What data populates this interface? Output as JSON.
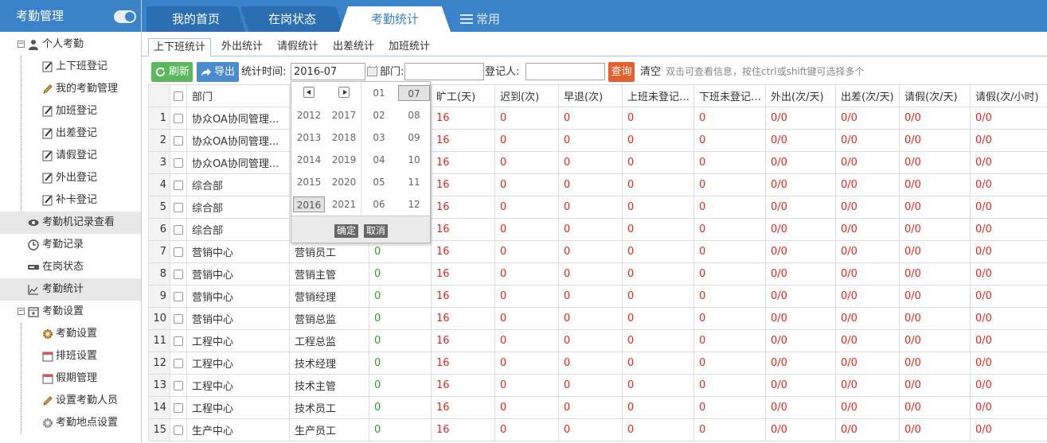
{
  "sidebar": {
    "title": "考勤管理",
    "groups": [
      {
        "label": "个人考勤",
        "icon": "user-icon",
        "items": [
          {
            "label": "上下班登记",
            "icon": "edit-icon"
          },
          {
            "label": "我的考勤管理",
            "icon": "pencil-icon"
          },
          {
            "label": "加班登记",
            "icon": "edit-icon"
          },
          {
            "label": "出差登记",
            "icon": "edit-icon"
          },
          {
            "label": "请假登记",
            "icon": "edit-icon"
          },
          {
            "label": "外出登记",
            "icon": "edit-icon"
          },
          {
            "label": "补卡登记",
            "icon": "edit-icon"
          }
        ]
      },
      {
        "label": "考勤机记录查看",
        "icon": "eye-icon"
      },
      {
        "label": "考勤记录",
        "icon": "clock-icon"
      },
      {
        "label": "在岗状态",
        "icon": "card-icon"
      },
      {
        "label": "考勤统计",
        "icon": "chart-icon"
      },
      {
        "label": "考勤设置",
        "icon": "calendar-plus-icon",
        "items": [
          {
            "label": "考勤设置",
            "icon": "gear-icon"
          },
          {
            "label": "排班设置",
            "icon": "calendar-icon"
          },
          {
            "label": "假期管理",
            "icon": "calendar-icon"
          },
          {
            "label": "设置考勤人员",
            "icon": "pencil-icon"
          },
          {
            "label": "考勤地点设置",
            "icon": "gear-icon"
          }
        ]
      }
    ]
  },
  "top_tabs": [
    "我的首页",
    "在岗状态",
    "考勤统计",
    "常用"
  ],
  "sub_tabs": [
    "上下班统计",
    "外出统计",
    "请假统计",
    "出差统计",
    "加班统计"
  ],
  "toolbar": {
    "refresh": "刷新",
    "export": "导出",
    "period_label": "统计时间:",
    "period_value": "2016-07",
    "dept_label": "部门:",
    "registrant_label": "登记人:",
    "query": "查询",
    "clear": "清空",
    "hint": "双击可查看信息，按住ctrl或shift键可选择多个"
  },
  "picker": {
    "years_left": [
      "2012",
      "2013",
      "2014",
      "2015",
      "2016"
    ],
    "years_right": [
      "2017",
      "2018",
      "2019",
      "2020",
      "2021"
    ],
    "months_left": [
      "01",
      "02",
      "03",
      "04",
      "05",
      "06"
    ],
    "months_right": [
      "07",
      "08",
      "09",
      "10",
      "11",
      "12"
    ],
    "selected_year": "2016",
    "selected_month": "07",
    "ok": "确定",
    "cancel": "取消"
  },
  "table": {
    "headers": [
      "部门",
      "",
      "",
      "旷工(天)",
      "迟到(次)",
      "早退(次)",
      "上班未登记(次)",
      "下班未登记(次)",
      "外出(次/天)",
      "出差(次/天)",
      "请假(次/天)",
      "请假(次/小时)"
    ],
    "rows": [
      {
        "no": "1",
        "dept": "协众OA协同管理...",
        "pos": "",
        "c1": "",
        "absent": "16",
        "late": "0",
        "early": "0",
        "nocheckin": "0",
        "nocheckout": "0",
        "out": "0/0",
        "trip": "0/0",
        "leave": "0/0",
        "leaveh": "0/0"
      },
      {
        "no": "2",
        "dept": "协众OA协同管理...",
        "pos": "",
        "c1": "",
        "absent": "16",
        "late": "0",
        "early": "0",
        "nocheckin": "0",
        "nocheckout": "0",
        "out": "0/0",
        "trip": "0/0",
        "leave": "0/0",
        "leaveh": "0/0"
      },
      {
        "no": "3",
        "dept": "协众OA协同管理...",
        "pos": "",
        "c1": "",
        "absent": "16",
        "late": "0",
        "early": "0",
        "nocheckin": "0",
        "nocheckout": "0",
        "out": "0/0",
        "trip": "0/0",
        "leave": "0/0",
        "leaveh": "0/0"
      },
      {
        "no": "4",
        "dept": "综合部",
        "pos": "",
        "c1": "",
        "absent": "16",
        "late": "0",
        "early": "0",
        "nocheckin": "0",
        "nocheckout": "0",
        "out": "0/0",
        "trip": "0/0",
        "leave": "0/0",
        "leaveh": "0/0"
      },
      {
        "no": "5",
        "dept": "综合部",
        "pos": "",
        "c1": "",
        "absent": "16",
        "late": "0",
        "early": "0",
        "nocheckin": "0",
        "nocheckout": "0",
        "out": "0/0",
        "trip": "0/0",
        "leave": "0/0",
        "leaveh": "0/0"
      },
      {
        "no": "6",
        "dept": "综合部",
        "pos": "",
        "c1": "",
        "absent": "16",
        "late": "0",
        "early": "0",
        "nocheckin": "0",
        "nocheckout": "0",
        "out": "0/0",
        "trip": "0/0",
        "leave": "0/0",
        "leaveh": "0/0"
      },
      {
        "no": "7",
        "dept": "营销中心",
        "pos": "营销员工",
        "c1": "0",
        "absent": "16",
        "late": "0",
        "early": "0",
        "nocheckin": "0",
        "nocheckout": "0",
        "out": "0/0",
        "trip": "0/0",
        "leave": "0/0",
        "leaveh": "0/0"
      },
      {
        "no": "8",
        "dept": "营销中心",
        "pos": "营销主管",
        "c1": "0",
        "absent": "16",
        "late": "0",
        "early": "0",
        "nocheckin": "0",
        "nocheckout": "0",
        "out": "0/0",
        "trip": "0/0",
        "leave": "0/0",
        "leaveh": "0/0"
      },
      {
        "no": "9",
        "dept": "营销中心",
        "pos": "营销经理",
        "c1": "0",
        "absent": "16",
        "late": "0",
        "early": "0",
        "nocheckin": "0",
        "nocheckout": "0",
        "out": "0/0",
        "trip": "0/0",
        "leave": "0/0",
        "leaveh": "0/0"
      },
      {
        "no": "10",
        "dept": "营销中心",
        "pos": "营销总监",
        "c1": "0",
        "absent": "16",
        "late": "0",
        "early": "0",
        "nocheckin": "0",
        "nocheckout": "0",
        "out": "0/0",
        "trip": "0/0",
        "leave": "0/0",
        "leaveh": "0/0"
      },
      {
        "no": "11",
        "dept": "工程中心",
        "pos": "工程总监",
        "c1": "0",
        "absent": "16",
        "late": "0",
        "early": "0",
        "nocheckin": "0",
        "nocheckout": "0",
        "out": "0/0",
        "trip": "0/0",
        "leave": "0/0",
        "leaveh": "0/0"
      },
      {
        "no": "12",
        "dept": "工程中心",
        "pos": "技术经理",
        "c1": "0",
        "absent": "16",
        "late": "0",
        "early": "0",
        "nocheckin": "0",
        "nocheckout": "0",
        "out": "0/0",
        "trip": "0/0",
        "leave": "0/0",
        "leaveh": "0/0"
      },
      {
        "no": "13",
        "dept": "工程中心",
        "pos": "技术主管",
        "c1": "0",
        "absent": "16",
        "late": "0",
        "early": "0",
        "nocheckin": "0",
        "nocheckout": "0",
        "out": "0/0",
        "trip": "0/0",
        "leave": "0/0",
        "leaveh": "0/0"
      },
      {
        "no": "14",
        "dept": "工程中心",
        "pos": "技术员工",
        "c1": "0",
        "absent": "16",
        "late": "0",
        "early": "0",
        "nocheckin": "0",
        "nocheckout": "0",
        "out": "0/0",
        "trip": "0/0",
        "leave": "0/0",
        "leaveh": "0/0"
      },
      {
        "no": "15",
        "dept": "生产中心",
        "pos": "生产员工",
        "c1": "0",
        "absent": "16",
        "late": "0",
        "early": "0",
        "nocheckin": "0",
        "nocheckout": "0",
        "out": "0/0",
        "trip": "0/0",
        "leave": "0/0",
        "leaveh": "0/0"
      }
    ]
  },
  "colors": {
    "brand": "#3b83c8",
    "refresh": "#5cb85c",
    "export": "#4a8ccc",
    "query": "#e4602e",
    "alert": "#e8261d",
    "ok": "#2e9e2e"
  }
}
